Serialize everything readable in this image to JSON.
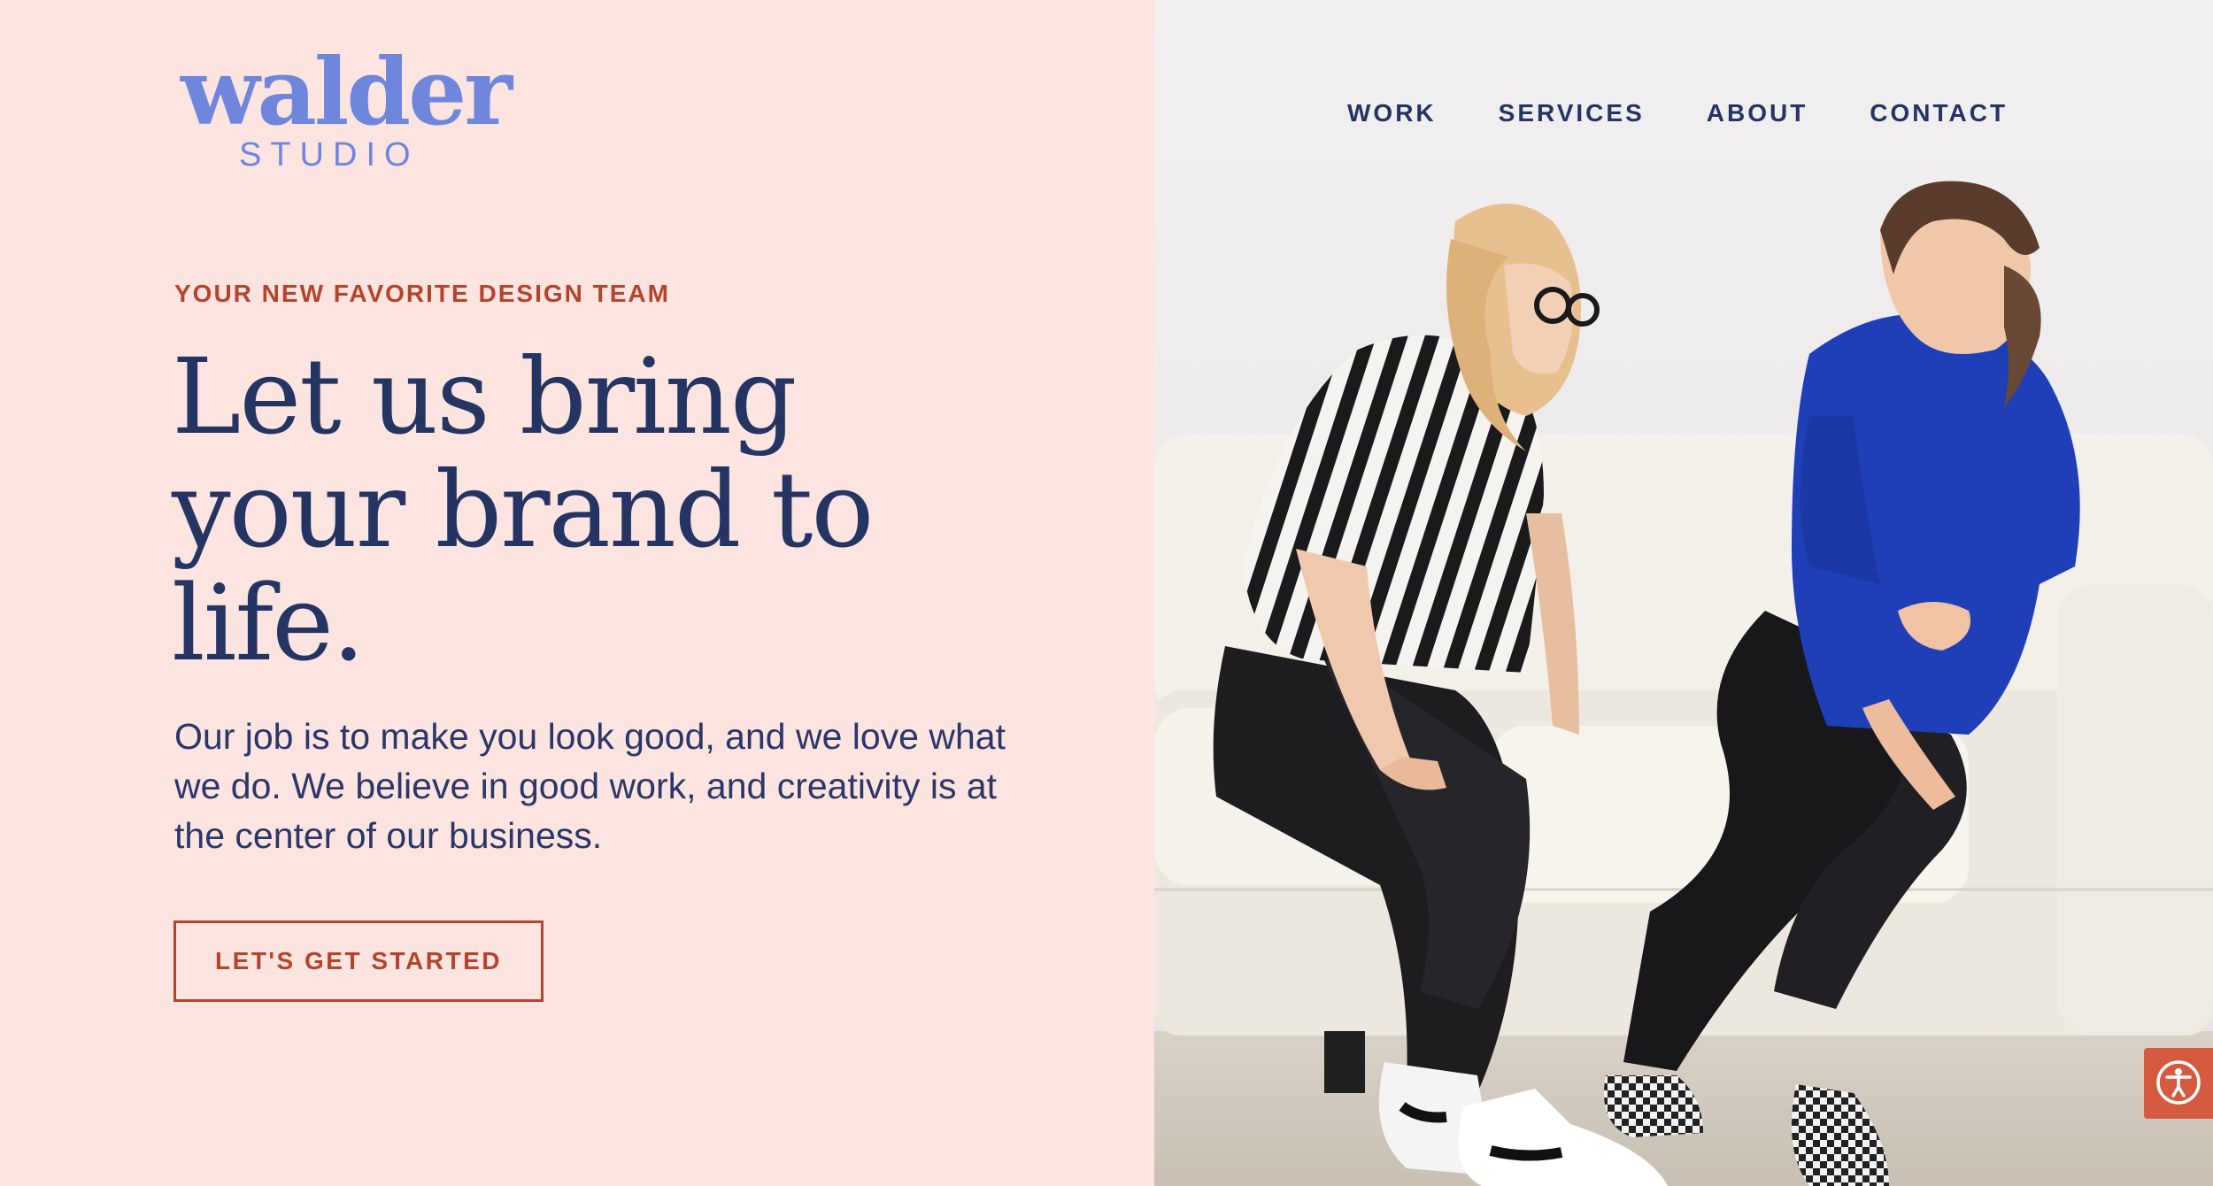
{
  "brand": {
    "name": "walder",
    "tagline": "STUDIO"
  },
  "nav": {
    "items": [
      {
        "label": "WORK"
      },
      {
        "label": "SERVICES"
      },
      {
        "label": "ABOUT"
      },
      {
        "label": "CONTACT"
      }
    ]
  },
  "hero": {
    "eyebrow": "YOUR NEW FAVORITE DESIGN TEAM",
    "headline": "Let us bring your brand to life.",
    "intro": "Our job is to make you look good, and we love what we do. We believe in good work, and creativity is at the center of our business.",
    "cta_label": "LET'S GET STARTED"
  },
  "icons": {
    "accessibility": "accessibility-icon"
  },
  "colors": {
    "background": "#fce5e1",
    "navy": "#243463",
    "accent_rust": "#b5442d",
    "logo_blue": "#6f86dd",
    "a11y_button": "#d65a3f"
  }
}
